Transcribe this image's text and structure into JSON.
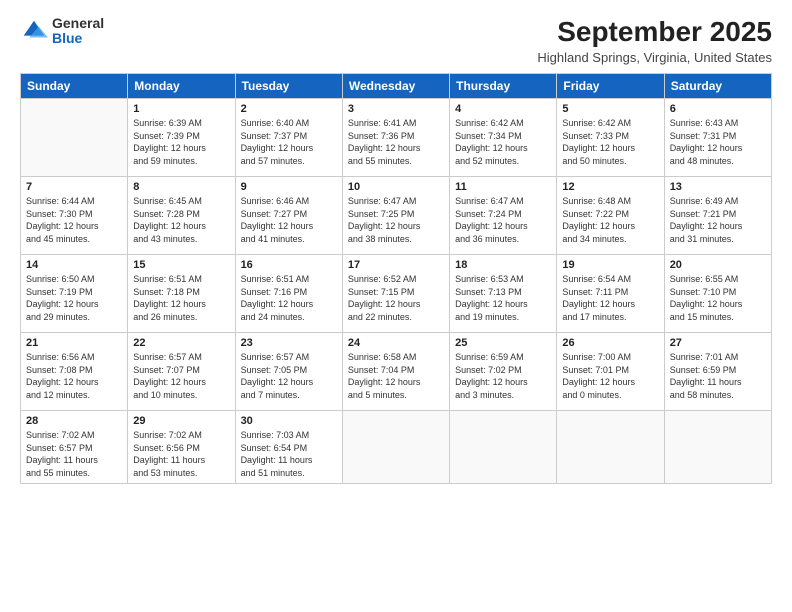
{
  "logo": {
    "general": "General",
    "blue": "Blue"
  },
  "title": "September 2025",
  "location": "Highland Springs, Virginia, United States",
  "days_header": [
    "Sunday",
    "Monday",
    "Tuesday",
    "Wednesday",
    "Thursday",
    "Friday",
    "Saturday"
  ],
  "weeks": [
    [
      {
        "num": "",
        "info": ""
      },
      {
        "num": "1",
        "info": "Sunrise: 6:39 AM\nSunset: 7:39 PM\nDaylight: 12 hours\nand 59 minutes."
      },
      {
        "num": "2",
        "info": "Sunrise: 6:40 AM\nSunset: 7:37 PM\nDaylight: 12 hours\nand 57 minutes."
      },
      {
        "num": "3",
        "info": "Sunrise: 6:41 AM\nSunset: 7:36 PM\nDaylight: 12 hours\nand 55 minutes."
      },
      {
        "num": "4",
        "info": "Sunrise: 6:42 AM\nSunset: 7:34 PM\nDaylight: 12 hours\nand 52 minutes."
      },
      {
        "num": "5",
        "info": "Sunrise: 6:42 AM\nSunset: 7:33 PM\nDaylight: 12 hours\nand 50 minutes."
      },
      {
        "num": "6",
        "info": "Sunrise: 6:43 AM\nSunset: 7:31 PM\nDaylight: 12 hours\nand 48 minutes."
      }
    ],
    [
      {
        "num": "7",
        "info": "Sunrise: 6:44 AM\nSunset: 7:30 PM\nDaylight: 12 hours\nand 45 minutes."
      },
      {
        "num": "8",
        "info": "Sunrise: 6:45 AM\nSunset: 7:28 PM\nDaylight: 12 hours\nand 43 minutes."
      },
      {
        "num": "9",
        "info": "Sunrise: 6:46 AM\nSunset: 7:27 PM\nDaylight: 12 hours\nand 41 minutes."
      },
      {
        "num": "10",
        "info": "Sunrise: 6:47 AM\nSunset: 7:25 PM\nDaylight: 12 hours\nand 38 minutes."
      },
      {
        "num": "11",
        "info": "Sunrise: 6:47 AM\nSunset: 7:24 PM\nDaylight: 12 hours\nand 36 minutes."
      },
      {
        "num": "12",
        "info": "Sunrise: 6:48 AM\nSunset: 7:22 PM\nDaylight: 12 hours\nand 34 minutes."
      },
      {
        "num": "13",
        "info": "Sunrise: 6:49 AM\nSunset: 7:21 PM\nDaylight: 12 hours\nand 31 minutes."
      }
    ],
    [
      {
        "num": "14",
        "info": "Sunrise: 6:50 AM\nSunset: 7:19 PM\nDaylight: 12 hours\nand 29 minutes."
      },
      {
        "num": "15",
        "info": "Sunrise: 6:51 AM\nSunset: 7:18 PM\nDaylight: 12 hours\nand 26 minutes."
      },
      {
        "num": "16",
        "info": "Sunrise: 6:51 AM\nSunset: 7:16 PM\nDaylight: 12 hours\nand 24 minutes."
      },
      {
        "num": "17",
        "info": "Sunrise: 6:52 AM\nSunset: 7:15 PM\nDaylight: 12 hours\nand 22 minutes."
      },
      {
        "num": "18",
        "info": "Sunrise: 6:53 AM\nSunset: 7:13 PM\nDaylight: 12 hours\nand 19 minutes."
      },
      {
        "num": "19",
        "info": "Sunrise: 6:54 AM\nSunset: 7:11 PM\nDaylight: 12 hours\nand 17 minutes."
      },
      {
        "num": "20",
        "info": "Sunrise: 6:55 AM\nSunset: 7:10 PM\nDaylight: 12 hours\nand 15 minutes."
      }
    ],
    [
      {
        "num": "21",
        "info": "Sunrise: 6:56 AM\nSunset: 7:08 PM\nDaylight: 12 hours\nand 12 minutes."
      },
      {
        "num": "22",
        "info": "Sunrise: 6:57 AM\nSunset: 7:07 PM\nDaylight: 12 hours\nand 10 minutes."
      },
      {
        "num": "23",
        "info": "Sunrise: 6:57 AM\nSunset: 7:05 PM\nDaylight: 12 hours\nand 7 minutes."
      },
      {
        "num": "24",
        "info": "Sunrise: 6:58 AM\nSunset: 7:04 PM\nDaylight: 12 hours\nand 5 minutes."
      },
      {
        "num": "25",
        "info": "Sunrise: 6:59 AM\nSunset: 7:02 PM\nDaylight: 12 hours\nand 3 minutes."
      },
      {
        "num": "26",
        "info": "Sunrise: 7:00 AM\nSunset: 7:01 PM\nDaylight: 12 hours\nand 0 minutes."
      },
      {
        "num": "27",
        "info": "Sunrise: 7:01 AM\nSunset: 6:59 PM\nDaylight: 11 hours\nand 58 minutes."
      }
    ],
    [
      {
        "num": "28",
        "info": "Sunrise: 7:02 AM\nSunset: 6:57 PM\nDaylight: 11 hours\nand 55 minutes."
      },
      {
        "num": "29",
        "info": "Sunrise: 7:02 AM\nSunset: 6:56 PM\nDaylight: 11 hours\nand 53 minutes."
      },
      {
        "num": "30",
        "info": "Sunrise: 7:03 AM\nSunset: 6:54 PM\nDaylight: 11 hours\nand 51 minutes."
      },
      {
        "num": "",
        "info": ""
      },
      {
        "num": "",
        "info": ""
      },
      {
        "num": "",
        "info": ""
      },
      {
        "num": "",
        "info": ""
      }
    ]
  ]
}
